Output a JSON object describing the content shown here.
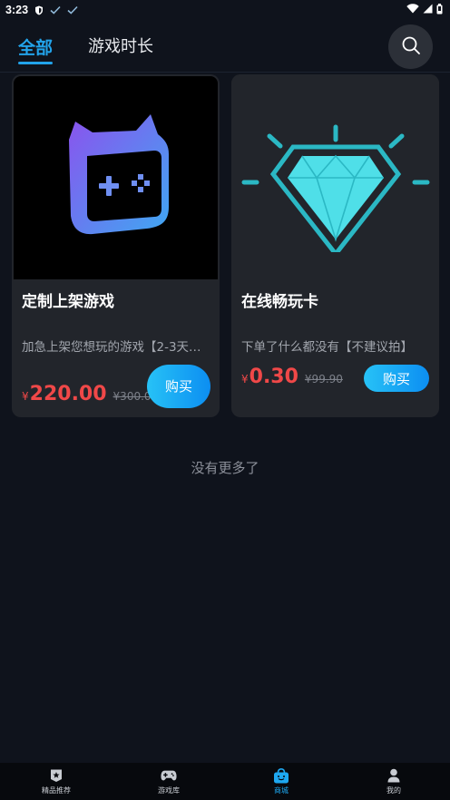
{
  "status_bar": {
    "time": "3:23",
    "icons": [
      "shield-icon",
      "check-icon",
      "check-icon"
    ],
    "right_icons": [
      "wifi-icon",
      "signal-icon",
      "battery-icon"
    ]
  },
  "header": {
    "tabs": [
      {
        "label": "全部",
        "active": true
      },
      {
        "label": "游戏时长",
        "active": false
      }
    ],
    "search_icon": "search-icon",
    "accent_color": "#22a3ea"
  },
  "products": [
    {
      "title": "定制上架游戏",
      "description": "加急上架您想玩的游戏【2-3天…",
      "currency": "¥",
      "price": "220.00",
      "original_price": "¥300.00",
      "buy_label": "购买",
      "image_icon": "gamepad-cat-icon"
    },
    {
      "title": "在线畅玩卡",
      "description": "下单了什么都没有【不建议拍】",
      "currency": "¥",
      "price": "0.30",
      "original_price": "¥99.90",
      "buy_label": "购买",
      "image_icon": "diamond-icon"
    }
  ],
  "footer_text": "没有更多了",
  "bottom_nav": [
    {
      "label": "精品推荐",
      "icon": "star-badge-icon",
      "active": false
    },
    {
      "label": "游戏库",
      "icon": "gamepad-icon",
      "active": false
    },
    {
      "label": "商城",
      "icon": "shopping-bag-icon",
      "active": true
    },
    {
      "label": "我的",
      "icon": "user-icon",
      "active": false
    }
  ],
  "colors": {
    "background": "#0f131c",
    "card": "#22252b",
    "price": "#f04848",
    "button_gradient_start": "#27c2f6",
    "button_gradient_end": "#0c8ef2"
  }
}
